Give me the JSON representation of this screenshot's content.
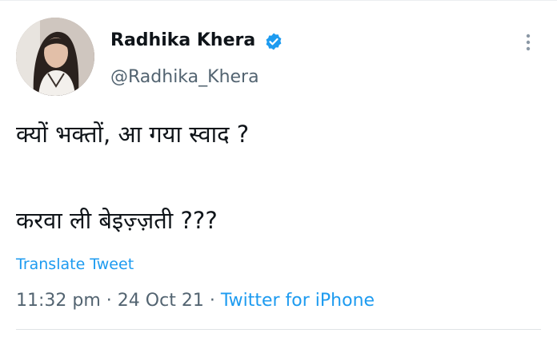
{
  "user": {
    "display_name": "Radhika Khera",
    "handle": "@Radhika_Khera",
    "verified": true,
    "avatar_icon": "profile-photo"
  },
  "tweet": {
    "line1": "क्यों भक्तों, आ गया स्वाद ?",
    "line2": "करवा ली बेइज़्ज़ती ???"
  },
  "actions": {
    "translate_label": "Translate Tweet",
    "more_icon": "more-vertical-icon"
  },
  "meta": {
    "time": "11:32 pm",
    "separator": "·",
    "date": "24 Oct 21",
    "source": "Twitter for iPhone"
  },
  "colors": {
    "accent": "#1d9bf0",
    "text": "#0f1419",
    "secondary": "#536471"
  }
}
